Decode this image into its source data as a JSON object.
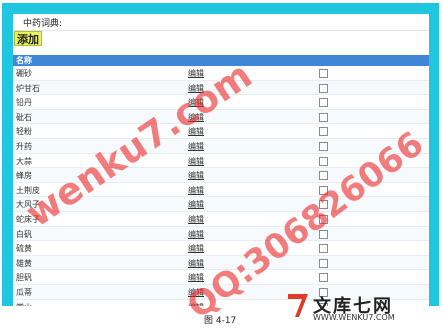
{
  "top_bar": {
    "label": "中药词典:"
  },
  "toolbar": {
    "add_label": "添加"
  },
  "table": {
    "header": "名称",
    "rows": [
      {
        "name": "硼砂",
        "edit": "编辑"
      },
      {
        "name": "炉甘石",
        "edit": "编辑"
      },
      {
        "name": "铅丹",
        "edit": "编辑"
      },
      {
        "name": "砒石",
        "edit": "编辑"
      },
      {
        "name": "轻粉",
        "edit": "编辑"
      },
      {
        "name": "升药",
        "edit": "编辑"
      },
      {
        "name": "大蒜",
        "edit": "编辑"
      },
      {
        "name": "蜂房",
        "edit": "编辑"
      },
      {
        "name": "土荆皮",
        "edit": "编辑"
      },
      {
        "name": "大风子",
        "edit": "编辑"
      },
      {
        "name": "蛇床子",
        "edit": "编辑"
      },
      {
        "name": "白矾",
        "edit": "编辑"
      },
      {
        "name": "硫黄",
        "edit": "编辑"
      },
      {
        "name": "雄黄",
        "edit": "编辑"
      },
      {
        "name": "胆矾",
        "edit": "编辑"
      },
      {
        "name": "瓜蒂",
        "edit": "编辑"
      },
      {
        "name": "常山",
        "edit": "编辑"
      }
    ]
  },
  "watermarks": {
    "site": "wenku7.com",
    "qq": "QQ:306826066"
  },
  "logo": {
    "text": "文库七网",
    "site": "WWW.WENKU7.COM"
  },
  "caption": "图 4-17",
  "colors": {
    "frame": "#1fc6e0",
    "header": "#3f86d6",
    "add_button": "#e8f25a",
    "watermark": "#eb2d2d"
  }
}
